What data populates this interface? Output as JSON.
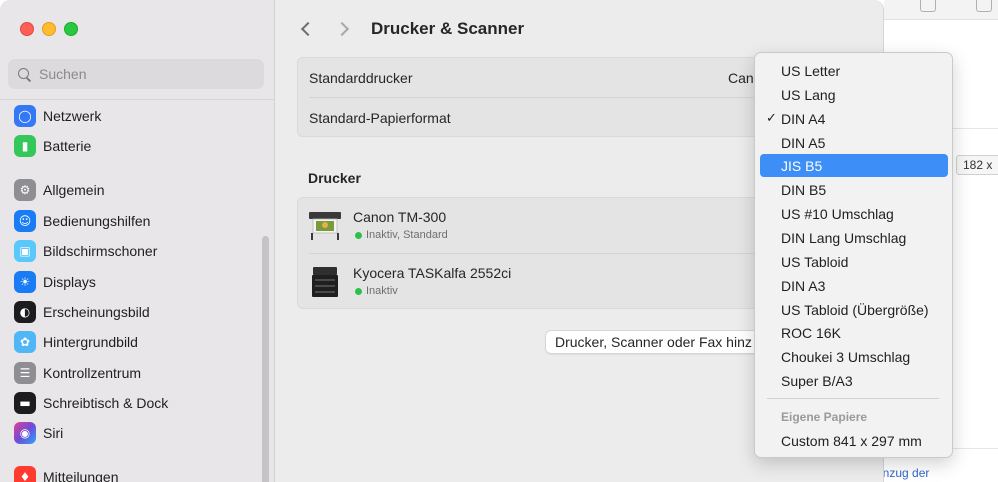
{
  "sidebar": {
    "search_placeholder": "Suchen",
    "items": [
      {
        "label": "Netzwerk",
        "icon": "globe-icon",
        "color": "#3478f6"
      },
      {
        "label": "Batterie",
        "icon": "battery-icon",
        "color": "#34c759"
      },
      {
        "label": "Allgemein",
        "icon": "gear-icon",
        "color": "#8e8e93"
      },
      {
        "label": "Bedienungshilfen",
        "icon": "accessibility-icon",
        "color": "#1a7cf5"
      },
      {
        "label": "Bildschirmschoner",
        "icon": "screensaver-icon",
        "color": "#5ac8fa"
      },
      {
        "label": "Displays",
        "icon": "sun-icon",
        "color": "#1a7cf5"
      },
      {
        "label": "Erscheinungsbild",
        "icon": "appearance-icon",
        "color": "#1c1c1e"
      },
      {
        "label": "Hintergrundbild",
        "icon": "flower-icon",
        "color": "#4fb7f5"
      },
      {
        "label": "Kontrollzentrum",
        "icon": "toggles-icon",
        "color": "#8e8e93"
      },
      {
        "label": "Schreibtisch & Dock",
        "icon": "dock-icon",
        "color": "#1c1c1e"
      },
      {
        "label": "Siri",
        "icon": "siri-icon",
        "color": "#6e4bd8"
      },
      {
        "label": "Mitteilungen",
        "icon": "bell-icon",
        "color": "#ff3b30"
      }
    ]
  },
  "main": {
    "title": "Drucker & Scanner",
    "default_printer_label": "Standarddrucker",
    "default_printer_value": "Can",
    "default_paper_label": "Standard-Papierformat",
    "printers_heading": "Drucker",
    "printers": [
      {
        "name": "Canon TM-300",
        "status": "Inaktiv, Standard",
        "icon": "large-format-printer-icon"
      },
      {
        "name": "Kyocera TASKalfa 2552ci",
        "status": "Inaktiv",
        "icon": "office-printer-icon"
      }
    ],
    "add_button_label": "Drucker, Scanner oder Fax hinz"
  },
  "paper_menu": {
    "options": [
      "US Letter",
      "US Lang",
      "DIN A4",
      "DIN A5",
      "JIS B5",
      "DIN B5",
      "US #10 Umschlag",
      "DIN Lang Umschlag",
      "US Tabloid",
      "DIN A3",
      "US Tabloid (Übergröße)",
      "ROC 16K",
      "Choukei 3 Umschlag",
      "Super B/A3"
    ],
    "checked": "DIN A4",
    "highlighted": "JIS B5",
    "custom_header": "Eigene Papiere",
    "custom_items": [
      "Custom 841 x 297 mm"
    ]
  },
  "background_window": {
    "size_badge": "182 x",
    "link_text": "anzug der"
  },
  "colors": {
    "accent": "#3d8ef7",
    "status_green": "#2bc148"
  }
}
